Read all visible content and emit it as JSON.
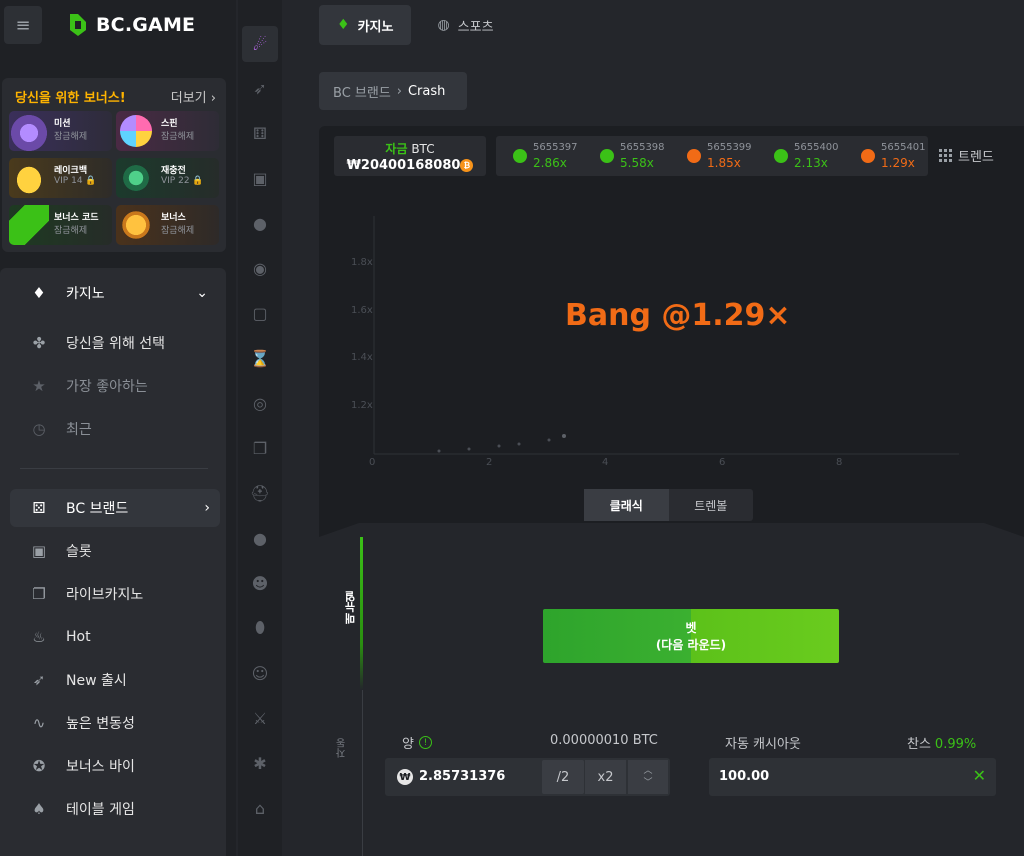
{
  "brand": {
    "name": "BC.GAME"
  },
  "bonus": {
    "title": "당신을 위한 보너스!",
    "more": "더보기",
    "tiles": [
      {
        "title": "미션",
        "sub": "잠금해제",
        "color": "#6b4aa8"
      },
      {
        "title": "스핀",
        "sub": "잠금해제",
        "color": "#8a2f6e"
      },
      {
        "title": "레이크백",
        "sub": "VIP 14 🔒",
        "color": "#a8781c"
      },
      {
        "title": "재충전",
        "sub": "VIP 22 🔒",
        "color": "#1f6b46"
      },
      {
        "title": "보너스 코드",
        "sub": "잠금해제",
        "color": "#2a7a2a"
      },
      {
        "title": "보너스",
        "sub": "잠금해제",
        "color": "#a8601c"
      }
    ]
  },
  "nav": {
    "casino": "카지노",
    "for_you": "당신을 위해 선택",
    "favorites": "가장 좋아하는",
    "recent": "최근",
    "bc_brand": "BC 브랜드",
    "slots": "슬롯",
    "live_casino": "라이브카지노",
    "hot": "Hot",
    "new_release": "New 출시",
    "high_volatility": "높은 변동성",
    "bonus_buy": "보너스 바이",
    "table_games": "테이블 게임"
  },
  "tabs": {
    "casino": "카지노",
    "sports": "스포츠"
  },
  "breadcrumb": {
    "parent": "BC 브랜드",
    "current": "Crash"
  },
  "balance": {
    "label_colored": "자금",
    "label_currency": "BTC",
    "amount": "₩20400168080"
  },
  "history": [
    {
      "id": "5655397",
      "value": "2.86x",
      "status": "green"
    },
    {
      "id": "5655398",
      "value": "5.58x",
      "status": "green"
    },
    {
      "id": "5655399",
      "value": "1.85x",
      "status": "orange"
    },
    {
      "id": "5655400",
      "value": "2.13x",
      "status": "green"
    },
    {
      "id": "5655401",
      "value": "1.29x",
      "status": "orange"
    }
  ],
  "trend_label": "트렌드",
  "chart": {
    "y_ticks": [
      "1.8x",
      "1.6x",
      "1.4x",
      "1.2x"
    ],
    "x_ticks": [
      "0",
      "2",
      "4",
      "6",
      "8"
    ]
  },
  "bang_text": "Bang @1.29×",
  "modes": {
    "classic": "클래식",
    "trenball": "트렌볼"
  },
  "side_tabs": {
    "manual": "매뉴얼",
    "auto": "자동"
  },
  "bet_button": {
    "line1": "벳",
    "line2": "(다음 라운드)"
  },
  "amount": {
    "label": "양",
    "btc": "0.00000010 BTC",
    "value": "2.85731376",
    "half": "/2",
    "double": "x2"
  },
  "auto_cashout": {
    "label": "자동 캐시아웃",
    "value": "100.00"
  },
  "chance": {
    "label": "찬스",
    "value": "0.99%"
  },
  "colors": {
    "accent": "#3bc117",
    "orange": "#f16b16",
    "gold": "#ffb400"
  }
}
